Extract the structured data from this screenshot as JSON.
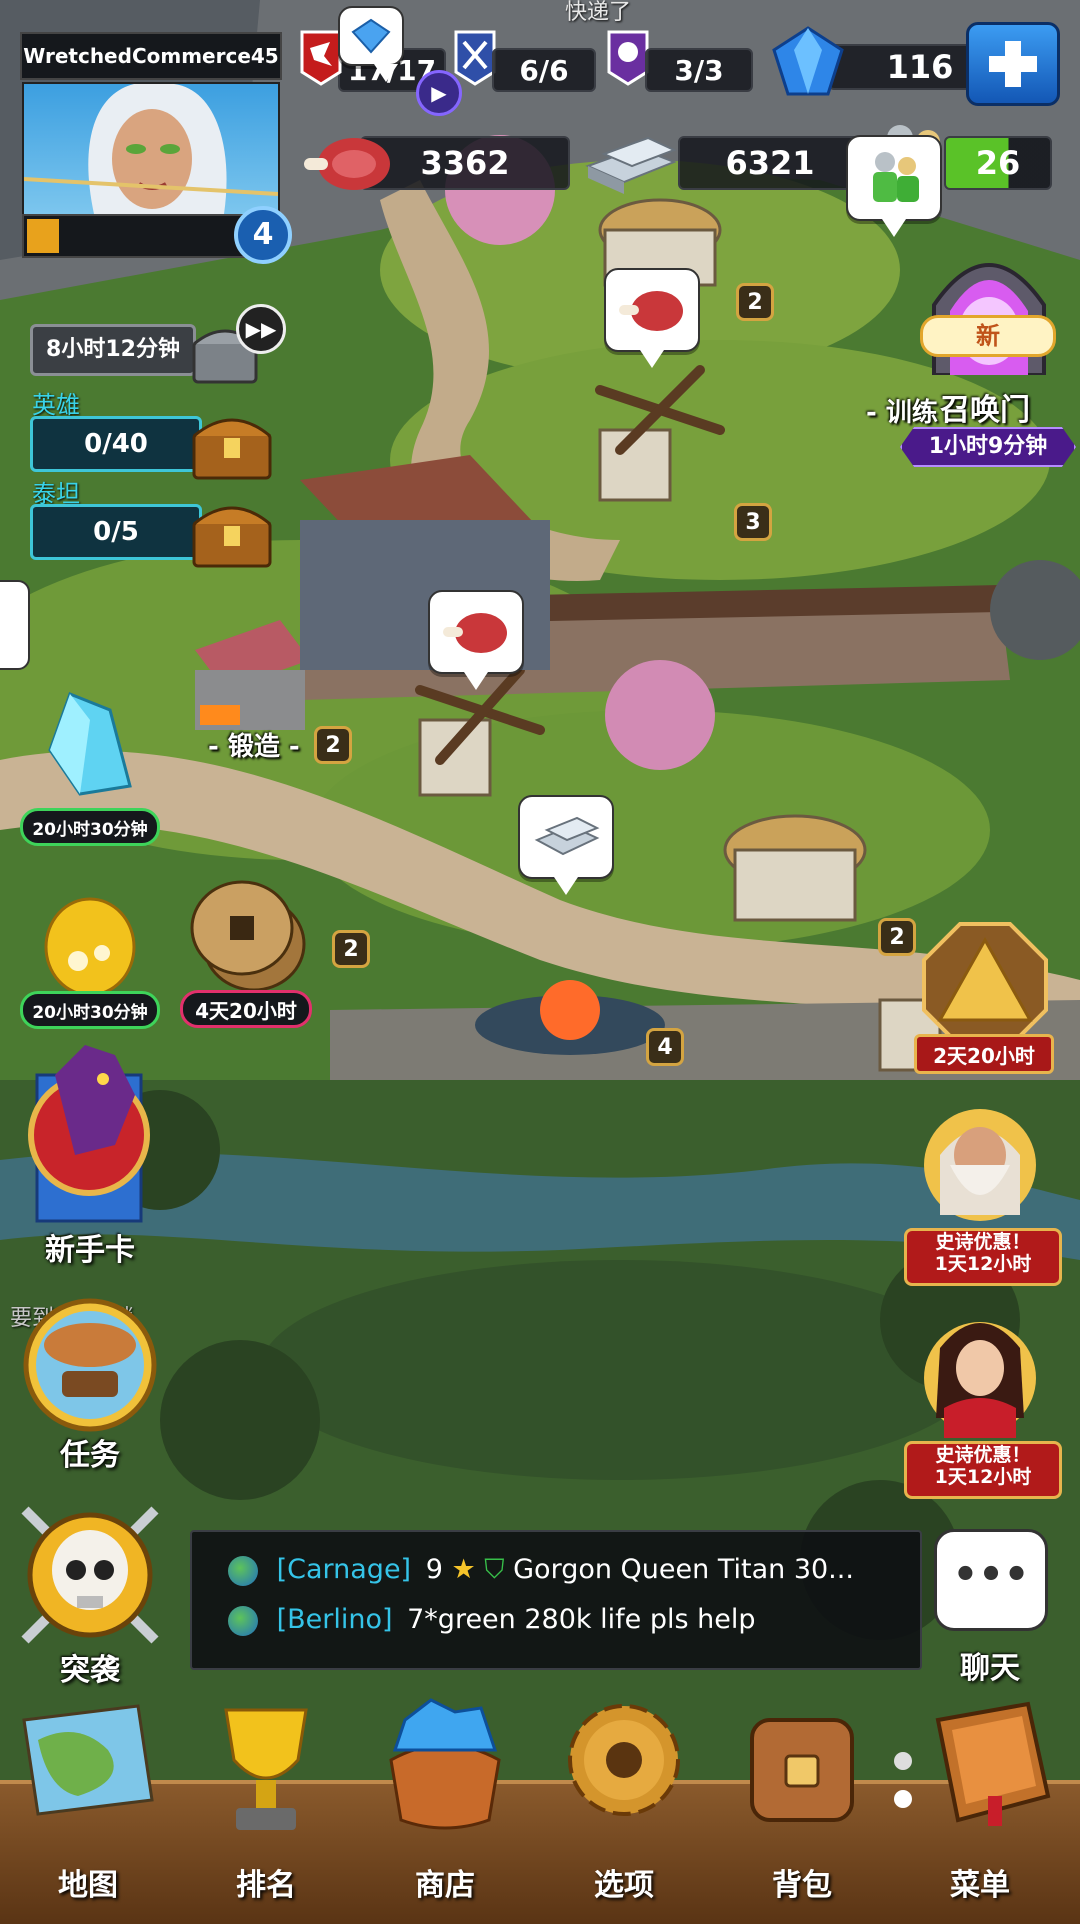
{
  "player": {
    "name": "WretchedCommerce45",
    "level": "4"
  },
  "top_status": {
    "announce": "快递了",
    "raids": "17/17",
    "war": "6/6",
    "titan": "3/3",
    "gems": "116"
  },
  "resources": {
    "food": "3362",
    "iron": "6321",
    "army": "26"
  },
  "left_panel": {
    "chest_timer": "8小时12分钟",
    "hero_label": "英雄",
    "hero_progress": "0/40",
    "titan_label": "泰坦",
    "titan_progress": "0/5",
    "crystal_timer": "20小时30分钟",
    "egg_timer": "20小时30分钟",
    "coins_timer": "4天20小时",
    "newbie_card": "新手卡",
    "unlock_hint": "要到5时解锁",
    "quests": "任务",
    "raid": "突袭"
  },
  "map": {
    "forge_label": "- 锻造 -",
    "forge_level": "2",
    "training_label": "- 训练",
    "portal_label": "召唤门",
    "portal_badge": "新",
    "portal_timer": "1小时9分钟",
    "levels": [
      "2",
      "3",
      "2",
      "4",
      "2"
    ]
  },
  "right_panel": {
    "pyramid_timer": "2天20小时",
    "offer1_title": "史诗优惠！",
    "offer1_time": "1天12小时",
    "offer2_title": "史诗优惠！",
    "offer2_time": "1天12小时",
    "chat": "聊天"
  },
  "chat_feed": [
    {
      "alliance": "[Carnage]",
      "text": "9",
      "rest": "Gorgon Queen Titan 30..."
    },
    {
      "alliance": "[Berlino]",
      "text": "7*green 280k life pls help",
      "rest": ""
    }
  ],
  "bottom_nav": [
    "地图",
    "排名",
    "商店",
    "选项",
    "背包",
    "菜单"
  ],
  "colors": {
    "grass": "#5d8a35",
    "path": "#cbb79a",
    "accent_blue": "#1e7ad8",
    "nav_bar": "#6a3f1c",
    "alliance": "#35c4e8"
  }
}
